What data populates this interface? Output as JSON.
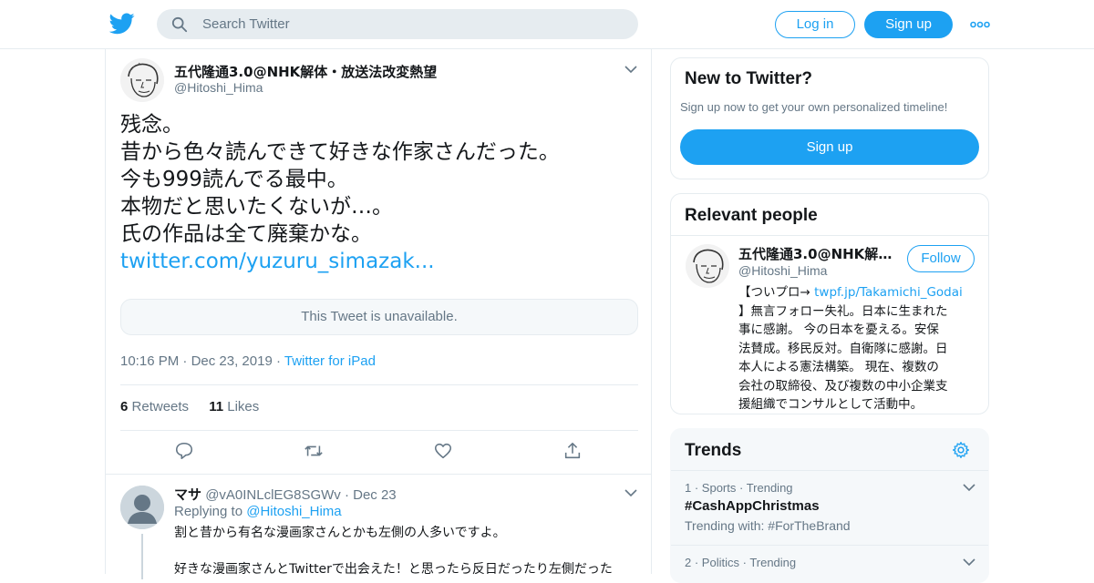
{
  "colors": {
    "accent": "#1da1f2",
    "muted": "#657786",
    "border": "#e6ecf0"
  },
  "header": {
    "logo_icon": "twitter-bird-icon",
    "search_placeholder": "Search Twitter",
    "login_label": "Log in",
    "signup_label": "Sign up",
    "more_icon": "more-dots-icon"
  },
  "tweet": {
    "author_name": "五代隆通3.0@NHK解体・放送法改変熱望",
    "author_handle": "@Hitoshi_Hima",
    "lines": [
      "残念。",
      "昔から色々読んできて好きな作家さんだった。",
      "今も999読んでる最中。",
      "本物だと思いたくないが…。",
      "氏の作品は全て廃棄かな。"
    ],
    "link": "twitter.com/yuzuru_simazak...",
    "quoted_unavailable": "This Tweet is unavailable.",
    "time": "10:16 PM",
    "date": "Dec 23, 2019",
    "source": "Twitter for iPad",
    "retweets_count": "6",
    "retweets_label": "Retweets",
    "likes_count": "11",
    "likes_label": "Likes"
  },
  "reply": {
    "name": "マサ",
    "handle": "@vA0INLclEG8SGWv",
    "date": "Dec 23",
    "replying_prefix": "Replying to",
    "replying_to": "@Hitoshi_Hima",
    "line1": "割と昔から有名な漫画家さんとかも左側の人多いですよ。",
    "line2": "好きな漫画家さんとTwitterで出会えた！と思ったら反日だったり左側だった"
  },
  "new_to_twitter": {
    "title": "New to Twitter?",
    "subtitle": "Sign up now to get your own personalized timeline!",
    "signup_label": "Sign up"
  },
  "relevant_people": {
    "title": "Relevant people",
    "name": "五代隆通3.0@NHK解体・放送法改変熱望",
    "handle": "@Hitoshi_Hima",
    "follow_label": "Follow",
    "bio_prefix": "【ついプロ→ ",
    "bio_link": "twpf.jp/Takamichi_Godai",
    "bio_lines": [
      "】無言フォロー失礼。日本に生まれた",
      "事に感謝。 今の日本を憂える。安保",
      "法賛成。移民反対。自衛隊に感謝。日",
      "本人による憲法構築。 現在、複数の",
      "会社の取締役、及び複数の中小企業支",
      "援組織でコンサルとして活動中。"
    ]
  },
  "trends": {
    "title": "Trends",
    "items": [
      {
        "rank": "1",
        "category": "Sports",
        "status": "Trending",
        "name": "#CashAppChristmas",
        "sub": "Trending with: #ForTheBrand"
      },
      {
        "rank": "2",
        "category": "Politics",
        "status": "Trending"
      }
    ]
  }
}
